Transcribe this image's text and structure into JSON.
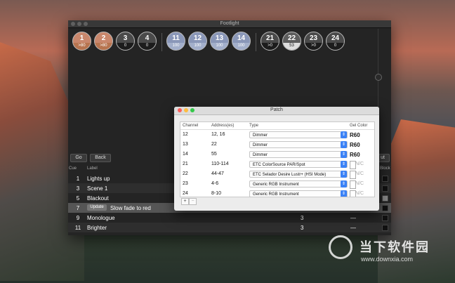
{
  "window": {
    "title": "Footlight"
  },
  "channels": [
    {
      "num": "1",
      "level": ">80"
    },
    {
      "num": "2",
      "level": ">80"
    },
    {
      "num": "3",
      "level": "0"
    },
    {
      "num": "4",
      "level": "0"
    },
    {
      "num": "11",
      "level": "100"
    },
    {
      "num": "12",
      "level": "100"
    },
    {
      "num": "13",
      "level": "100"
    },
    {
      "num": "14",
      "level": "100"
    },
    {
      "num": "21",
      "level": ">0"
    },
    {
      "num": "22",
      "level": "53"
    },
    {
      "num": "23",
      "level": ">0"
    },
    {
      "num": "24",
      "level": "0"
    }
  ],
  "controls": {
    "go": "Go",
    "back": "Back",
    "out": "ut"
  },
  "cue_headers": {
    "cue": "Cue",
    "label": "Label",
    "block": "Block"
  },
  "cues": [
    {
      "cue": "1",
      "label": "Lights up",
      "time": "",
      "dash": "",
      "block": false
    },
    {
      "cue": "3",
      "label": "Scene 1",
      "time": "",
      "dash": "",
      "block": false
    },
    {
      "cue": "5",
      "label": "Blackout",
      "time": "",
      "dash": "",
      "block": true
    },
    {
      "cue": "7",
      "label": "Slow fade to red",
      "time": "",
      "dash": "",
      "block": false,
      "update": "Update"
    },
    {
      "cue": "9",
      "label": "Monologue",
      "time": "3",
      "dash": "—",
      "block": false
    },
    {
      "cue": "11",
      "label": "Brighter",
      "time": "3",
      "dash": "—",
      "block": false
    }
  ],
  "patch": {
    "title": "Patch",
    "headers": {
      "channel": "Channel",
      "address": "Address(es)",
      "type": "Type",
      "gel": "Gel Color"
    },
    "rows": [
      {
        "channel": "12",
        "address": "12, 16",
        "type": "Dimmer",
        "gel": "R60"
      },
      {
        "channel": "13",
        "address": "22",
        "type": "Dimmer",
        "gel": "R60"
      },
      {
        "channel": "14",
        "address": "55",
        "type": "Dimmer",
        "gel": "R60"
      },
      {
        "channel": "21",
        "address": "110-114",
        "type": "ETC ColorSource PAR/Spot",
        "gel": "N/C"
      },
      {
        "channel": "22",
        "address": "44-47",
        "type": "ETC Selador Desire Lustr+ (HSI Mode)",
        "gel": "N/C"
      },
      {
        "channel": "23",
        "address": "4-6",
        "type": "Generic RGB Instrument",
        "gel": "N/C"
      },
      {
        "channel": "24",
        "address": "8-10",
        "type": "Generic RGB Instrument",
        "gel": "N/C"
      }
    ],
    "add": "+",
    "remove": "−"
  },
  "watermark": {
    "text": "当下软件园",
    "url": "www.downxia.com"
  }
}
